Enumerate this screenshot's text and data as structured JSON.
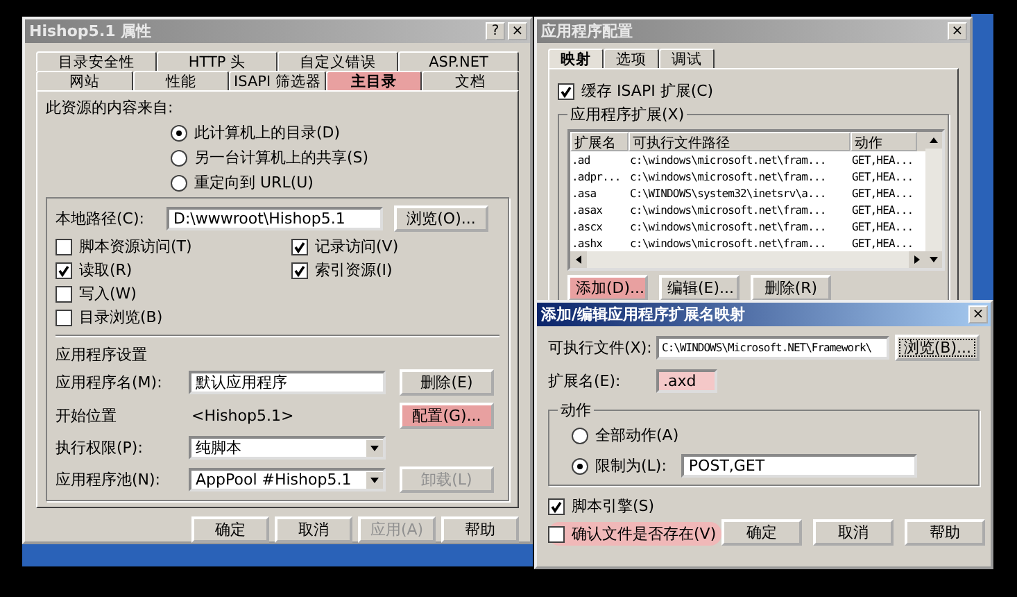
{
  "properties_dialog": {
    "title": "Hishop5.1 属性",
    "title_buttons": [
      "?",
      "×"
    ],
    "tab_rows": [
      [
        {
          "label": "目录安全性",
          "selected": false,
          "highlighted": false
        },
        {
          "label": "HTTP 头",
          "selected": false,
          "highlighted": false
        },
        {
          "label": "自定义错误",
          "selected": false,
          "highlighted": false
        },
        {
          "label": "ASP.NET",
          "selected": false,
          "highlighted": false
        }
      ],
      [
        {
          "label": "网站",
          "selected": false,
          "highlighted": false
        },
        {
          "label": "性能",
          "selected": false,
          "highlighted": false
        },
        {
          "label": "ISAPI 筛选器",
          "selected": false,
          "highlighted": false
        },
        {
          "label": "主目录",
          "selected": true,
          "highlighted": true
        },
        {
          "label": "文档",
          "selected": false,
          "highlighted": false
        }
      ]
    ],
    "source_label": "此资源的内容来自:",
    "source_options": [
      {
        "label": "此计算机上的目录(D)",
        "selected": true
      },
      {
        "label": "另一台计算机上的共享(S)",
        "selected": false
      },
      {
        "label": "重定向到 URL(U)",
        "selected": false
      }
    ],
    "local_path": {
      "label": "本地路径(C):",
      "value": "D:\\wwwroot\\Hishop5.1",
      "button": "浏览(O)..."
    },
    "permissions_left": [
      {
        "label": "脚本资源访问(T)",
        "checked": false
      },
      {
        "label": "读取(R)",
        "checked": true
      },
      {
        "label": "写入(W)",
        "checked": false
      },
      {
        "label": "目录浏览(B)",
        "checked": false
      }
    ],
    "permissions_right": [
      {
        "label": "记录访问(V)",
        "checked": true
      },
      {
        "label": "索引资源(I)",
        "checked": true
      }
    ],
    "app_settings": {
      "heading": "应用程序设置",
      "rows": [
        {
          "kind": "field",
          "label": "应用程序名(M):",
          "value": "默认应用程序",
          "button": {
            "label": "删除(E)",
            "disabled": false,
            "highlighted": false
          }
        },
        {
          "kind": "text",
          "label": "开始位置",
          "value": "<Hishop5.1>",
          "button": {
            "label": "配置(G)...",
            "disabled": false,
            "highlighted": true
          }
        },
        {
          "kind": "select",
          "label": "执行权限(P):",
          "value": "纯脚本"
        },
        {
          "kind": "select",
          "label": "应用程序池(N):",
          "value": "AppPool #Hishop5.1",
          "button": {
            "label": "卸载(L)",
            "disabled": true,
            "highlighted": false
          }
        }
      ]
    },
    "footer_buttons": [
      {
        "label": "确定",
        "disabled": false
      },
      {
        "label": "取消",
        "disabled": false
      },
      {
        "label": "应用(A)",
        "disabled": true
      },
      {
        "label": "帮助",
        "disabled": false
      }
    ]
  },
  "app_config_dialog": {
    "title": "应用程序配置",
    "close": "×",
    "tabs": [
      {
        "label": "映射",
        "selected": true
      },
      {
        "label": "选项",
        "selected": false
      },
      {
        "label": "调试",
        "selected": false
      }
    ],
    "cache_isapi": {
      "label": "缓存 ISAPI 扩展(C)",
      "checked": true
    },
    "extensions_group": "应用程序扩展(X)",
    "columns": [
      "扩展名",
      "可执行文件路径",
      "动作"
    ],
    "rows": [
      {
        "ext": ".ad",
        "path": "c:\\windows\\microsoft.net\\fram...",
        "verbs": "GET,HEA..."
      },
      {
        "ext": ".adpr...",
        "path": "c:\\windows\\microsoft.net\\fram...",
        "verbs": "GET,HEA..."
      },
      {
        "ext": ".asa",
        "path": "C:\\WINDOWS\\system32\\inetsrv\\a...",
        "verbs": "GET,HEA..."
      },
      {
        "ext": ".asax",
        "path": "c:\\windows\\microsoft.net\\fram...",
        "verbs": "GET,HEA..."
      },
      {
        "ext": ".ascx",
        "path": "c:\\windows\\microsoft.net\\fram...",
        "verbs": "GET,HEA..."
      },
      {
        "ext": ".ashx",
        "path": "c:\\windows\\microsoft.net\\fram...",
        "verbs": "GET,HEA..."
      }
    ],
    "buttons": [
      {
        "label": "添加(D)...",
        "highlighted": true
      },
      {
        "label": "编辑(E)...",
        "highlighted": false
      },
      {
        "label": "删除(R)",
        "highlighted": false
      }
    ]
  },
  "mapping_dialog": {
    "title": "添加/编辑应用程序扩展名映射",
    "close": "×",
    "executable": {
      "label": "可执行文件(X):",
      "value": "C:\\WINDOWS\\Microsoft.NET\\Framework\\",
      "button": "浏览(B)..."
    },
    "extension": {
      "label": "扩展名(E):",
      "value": ".axd",
      "highlighted": true
    },
    "verbs_group": "动作",
    "verb_options": [
      {
        "label": "全部动作(A)",
        "selected": false
      },
      {
        "label": "限制为(L):",
        "selected": true,
        "value": "POST,GET"
      }
    ],
    "checks": [
      {
        "label": "脚本引擎(S)",
        "checked": true,
        "highlighted": false
      },
      {
        "label": "确认文件是否存在(V)",
        "checked": false,
        "highlighted": true
      }
    ],
    "buttons": [
      {
        "label": "确定"
      },
      {
        "label": "取消"
      },
      {
        "label": "帮助"
      }
    ]
  }
}
